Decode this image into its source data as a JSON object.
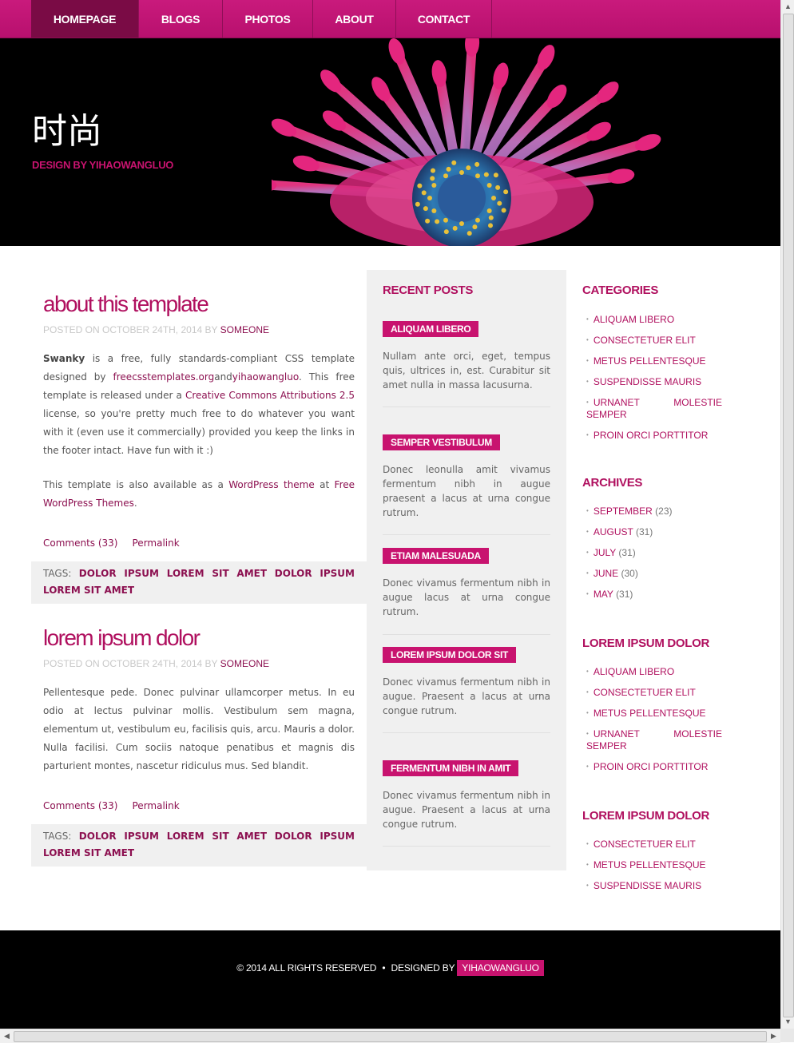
{
  "nav": {
    "items": [
      {
        "label": "HOMEPAGE"
      },
      {
        "label": "BLOGS"
      },
      {
        "label": "PHOTOS"
      },
      {
        "label": "ABOUT"
      },
      {
        "label": "CONTACT"
      }
    ]
  },
  "header": {
    "title": "时尚",
    "subtitle": "DESIGN BY YIHAOWANGLUO"
  },
  "posts": [
    {
      "title": "about this template",
      "meta_prefix": "POSTED ON OCTOBER 24TH, 2014 BY",
      "author": "SOMEONE",
      "p1_bold": "Swanky",
      "p1_a": " is a free, fully standards-compliant CSS template designed by ",
      "p1_link1": "freecsstemplates.org",
      "p1_b": "and",
      "p1_link2": "yihaowangluo",
      "p1_c": ". This free template is released under a ",
      "p1_link3": "Creative Commons Attributions 2.5",
      "p1_d": " license, so you're pretty much free to do whatever you want with it (even use it commercially) provided you keep the links in the footer intact. Have fun with it :)",
      "p2_a": "This template is also available as a ",
      "p2_link1": "WordPress theme",
      "p2_b": " at ",
      "p2_link2": "Free WordPress Themes",
      "p2_c": ".",
      "comments": "Comments (33)",
      "permalink": "Permalink",
      "tags_label": "TAGS:",
      "tags": "DOLOR IPSUM LOREM SIT AMET DOLOR IPSUM LOREM SIT AMET"
    },
    {
      "title": "lorem ipsum dolor",
      "meta_prefix": "POSTED ON OCTOBER 24TH, 2014 BY",
      "author": "SOMEONE",
      "body": "Pellentesque pede. Donec pulvinar ullamcorper metus. In eu odio at lectus pulvinar mollis. Vestibulum sem magna, elementum ut, vestibulum eu, facilisis quis, arcu. Mauris a dolor. Nulla facilisi. Cum sociis natoque penatibus et magnis dis parturient montes, nascetur ridiculus mus. Sed blandit.",
      "comments": "Comments (33)",
      "permalink": "Permalink",
      "tags_label": "TAGS:",
      "tags": "DOLOR IPSUM LOREM SIT AMET DOLOR IPSUM LOREM SIT AMET"
    }
  ],
  "recent": {
    "heading": "RECENT POSTS",
    "items": [
      {
        "title": "ALIQUAM LIBERO",
        "text": "Nullam ante orci, eget, tempus quis, ultrices in, est. Curabitur sit amet nulla in massa lacusurna."
      },
      {
        "title": "SEMPER VESTIBULUM",
        "text": "Donec leonulla amit vivamus fermentum nibh in augue praesent a lacus at urna congue rutrum."
      },
      {
        "title": "ETIAM MALESUADA",
        "text": "Donec vivamus fermentum nibh in augue lacus at urna congue rutrum."
      },
      {
        "title": "LOREM IPSUM DOLOR SIT",
        "text": "Donec vivamus fermentum nibh in augue. Praesent a lacus at urna congue rutrum."
      },
      {
        "title": "FERMENTUM NIBH IN AMIT",
        "text": "Donec vivamus fermentum nibh in augue. Praesent a lacus at urna congue rutrum."
      }
    ]
  },
  "categories": {
    "heading": "CATEGORIES",
    "items": [
      "ALIQUAM LIBERO",
      "CONSECTETUER ELIT",
      "METUS PELLENTESQUE",
      "SUSPENDISSE MAURIS",
      "URNANET MOLESTIE SEMPER",
      "PROIN ORCI PORTTITOR"
    ]
  },
  "archives": {
    "heading": "ARCHIVES",
    "items": [
      {
        "month": "SEPTEMBER",
        "count": "(23)"
      },
      {
        "month": "AUGUST",
        "count": "(31)"
      },
      {
        "month": "JULY",
        "count": "(31)"
      },
      {
        "month": "JUNE",
        "count": "(30)"
      },
      {
        "month": "MAY",
        "count": "(31)"
      }
    ]
  },
  "lorem1": {
    "heading": "LOREM IPSUM DOLOR",
    "items": [
      "ALIQUAM LIBERO",
      "CONSECTETUER ELIT",
      "METUS PELLENTESQUE",
      "URNANET MOLESTIE SEMPER",
      "PROIN ORCI PORTTITOR"
    ]
  },
  "lorem2": {
    "heading": "LOREM IPSUM DOLOR",
    "items": [
      "CONSECTETUER ELIT",
      "METUS PELLENTESQUE",
      "SUSPENDISSE MAURIS"
    ]
  },
  "footer": {
    "copyright": "© 2014 ALL RIGHTS RESERVED",
    "separator": "•",
    "designed_by": "DESIGNED BY",
    "designer": "YIHAOWANGLUO"
  },
  "colors": {
    "accent": "#c8136f",
    "nav_active": "#7a0b45",
    "header_bg": "#000000"
  }
}
